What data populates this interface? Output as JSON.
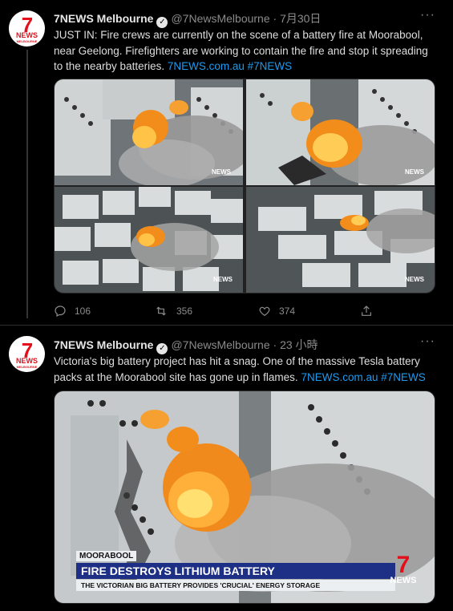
{
  "tweets": [
    {
      "author": "7NEWS Melbourne",
      "handle": "@7NewsMelbourne",
      "separator": "·",
      "time": "7月30日",
      "text": "JUST IN: Fire crews are currently on the scene of a battery fire at Moorabool, near Geelong. Firefighters are working to contain the fire and stop it spreading to the nearby batteries.",
      "link1": "7NEWS.com.au",
      "link2": "#7NEWS",
      "replies": "106",
      "retweets": "356",
      "likes": "374",
      "watermark": "NEWS"
    },
    {
      "author": "7NEWS Melbourne",
      "handle": "@7NewsMelbourne",
      "separator": "·",
      "time": "23 小時",
      "text": "Victoria's big battery project has hit a snag. One of the massive Tesla battery packs at the Moorabool site has gone up in flames.",
      "link1": "7NEWS.com.au",
      "link2": "#7NEWS",
      "lower_third": {
        "location": "MOORABOOL",
        "headline": "FIRE DESTROYS LITHIUM BATTERY",
        "subline": "THE VICTORIAN BIG BATTERY PROVIDES 'CRUCIAL' ENERGY STORAGE"
      },
      "logo_number": "7",
      "logo_word": "NEWS"
    }
  ],
  "avatar": {
    "number": "7",
    "word": "NEWS",
    "sub": "MELBOURNE"
  },
  "icons": [
    "reply-icon",
    "retweet-icon",
    "like-icon",
    "share-icon",
    "verified-icon",
    "more-icon"
  ]
}
